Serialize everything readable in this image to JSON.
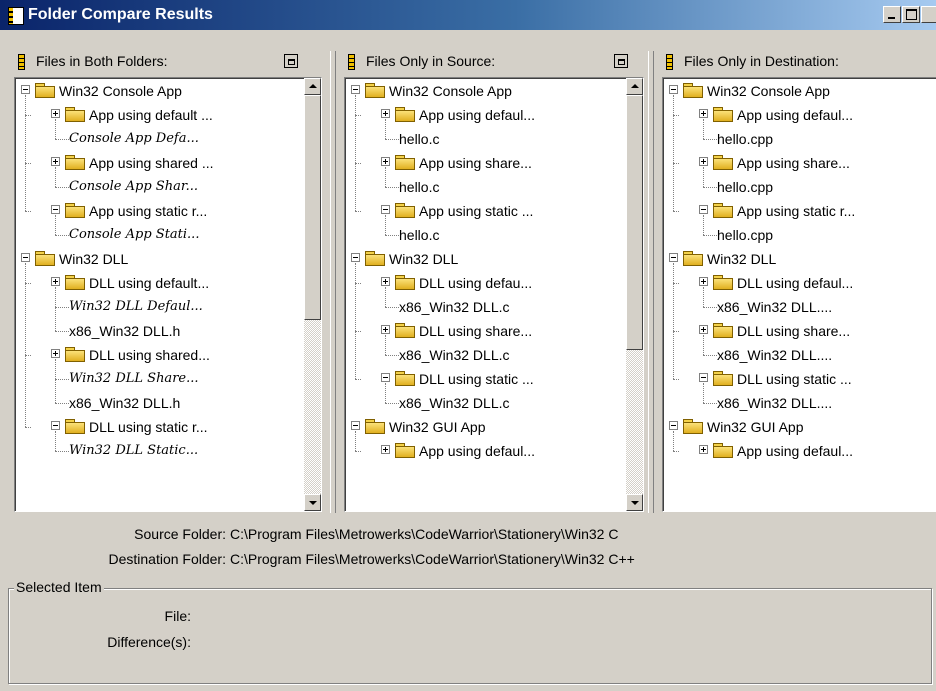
{
  "window": {
    "title": "Folder Compare Results"
  },
  "panes": [
    {
      "header": "Files in Both Folders:",
      "rows": [
        {
          "type": "folder",
          "level": 0,
          "label": "Win32 Console App",
          "expanded": true
        },
        {
          "type": "folder",
          "level": 1,
          "label": "App using default ...",
          "expanded": false
        },
        {
          "type": "file",
          "level": 2,
          "label": "Console App Defa...",
          "italic": true
        },
        {
          "type": "folder",
          "level": 1,
          "label": "App using shared ...",
          "expanded": false
        },
        {
          "type": "file",
          "level": 2,
          "label": "Console App Shar...",
          "italic": true
        },
        {
          "type": "folder",
          "level": 1,
          "label": "App using static r...",
          "expanded": true
        },
        {
          "type": "file",
          "level": 2,
          "label": "Console App Stati...",
          "italic": true
        },
        {
          "type": "folder",
          "level": 0,
          "label": "Win32 DLL",
          "expanded": true
        },
        {
          "type": "folder",
          "level": 1,
          "label": "DLL using default...",
          "expanded": false
        },
        {
          "type": "file",
          "level": 2,
          "label": "Win32 DLL Defaul...",
          "italic": true
        },
        {
          "type": "file",
          "level": 2,
          "label": "x86_Win32 DLL.h",
          "italic": false
        },
        {
          "type": "folder",
          "level": 1,
          "label": "DLL using shared...",
          "expanded": false
        },
        {
          "type": "file",
          "level": 2,
          "label": "Win32 DLL Share...",
          "italic": true
        },
        {
          "type": "file",
          "level": 2,
          "label": "x86_Win32 DLL.h",
          "italic": false
        },
        {
          "type": "folder",
          "level": 1,
          "label": "DLL using static r...",
          "expanded": true
        },
        {
          "type": "file",
          "level": 2,
          "label": "Win32 DLL Static...",
          "italic": true
        }
      ]
    },
    {
      "header": "Files Only in Source:",
      "rows": [
        {
          "type": "folder",
          "level": 0,
          "label": "Win32 Console App",
          "expanded": true
        },
        {
          "type": "folder",
          "level": 1,
          "label": "App using defaul...",
          "expanded": false
        },
        {
          "type": "file",
          "level": 2,
          "label": "hello.c",
          "italic": false
        },
        {
          "type": "folder",
          "level": 1,
          "label": "App using share...",
          "expanded": false
        },
        {
          "type": "file",
          "level": 2,
          "label": "hello.c",
          "italic": false
        },
        {
          "type": "folder",
          "level": 1,
          "label": "App using static ...",
          "expanded": true
        },
        {
          "type": "file",
          "level": 2,
          "label": "hello.c",
          "italic": false
        },
        {
          "type": "folder",
          "level": 0,
          "label": "Win32 DLL",
          "expanded": true
        },
        {
          "type": "folder",
          "level": 1,
          "label": "DLL using defau...",
          "expanded": false
        },
        {
          "type": "file",
          "level": 2,
          "label": "x86_Win32 DLL.c",
          "italic": false
        },
        {
          "type": "folder",
          "level": 1,
          "label": "DLL using share...",
          "expanded": false
        },
        {
          "type": "file",
          "level": 2,
          "label": "x86_Win32 DLL.c",
          "italic": false
        },
        {
          "type": "folder",
          "level": 1,
          "label": "DLL using static ...",
          "expanded": true
        },
        {
          "type": "file",
          "level": 2,
          "label": "x86_Win32 DLL.c",
          "italic": false
        },
        {
          "type": "folder",
          "level": 0,
          "label": "Win32 GUI App",
          "expanded": true
        },
        {
          "type": "folder",
          "level": 1,
          "label": "App using defaul...",
          "expanded": false
        }
      ]
    },
    {
      "header": "Files Only in Destination:",
      "rows": [
        {
          "type": "folder",
          "level": 0,
          "label": "Win32 Console App",
          "expanded": true
        },
        {
          "type": "folder",
          "level": 1,
          "label": "App using defaul...",
          "expanded": false
        },
        {
          "type": "file",
          "level": 2,
          "label": "hello.cpp",
          "italic": false
        },
        {
          "type": "folder",
          "level": 1,
          "label": "App using share...",
          "expanded": false
        },
        {
          "type": "file",
          "level": 2,
          "label": "hello.cpp",
          "italic": false
        },
        {
          "type": "folder",
          "level": 1,
          "label": "App using static r...",
          "expanded": true
        },
        {
          "type": "file",
          "level": 2,
          "label": "hello.cpp",
          "italic": false
        },
        {
          "type": "folder",
          "level": 0,
          "label": "Win32 DLL",
          "expanded": true
        },
        {
          "type": "folder",
          "level": 1,
          "label": "DLL using defaul...",
          "expanded": false
        },
        {
          "type": "file",
          "level": 2,
          "label": "x86_Win32 DLL....",
          "italic": false
        },
        {
          "type": "folder",
          "level": 1,
          "label": "DLL using share...",
          "expanded": false
        },
        {
          "type": "file",
          "level": 2,
          "label": "x86_Win32 DLL....",
          "italic": false
        },
        {
          "type": "folder",
          "level": 1,
          "label": "DLL using static ...",
          "expanded": true
        },
        {
          "type": "file",
          "level": 2,
          "label": "x86_Win32 DLL....",
          "italic": false
        },
        {
          "type": "folder",
          "level": 0,
          "label": "Win32 GUI App",
          "expanded": true
        },
        {
          "type": "folder",
          "level": 1,
          "label": "App using defaul...",
          "expanded": false
        }
      ]
    }
  ],
  "info": {
    "source_label": "Source Folder:",
    "source_value": "C:\\Program Files\\Metrowerks\\CodeWarrior\\Stationery\\Win32 C",
    "dest_label": "Destination Folder:",
    "dest_value": "C:\\Program Files\\Metrowerks\\CodeWarrior\\Stationery\\Win32 C++"
  },
  "selected": {
    "group_title": "Selected Item",
    "file_label": "File:",
    "diff_label": "Difference(s):"
  }
}
